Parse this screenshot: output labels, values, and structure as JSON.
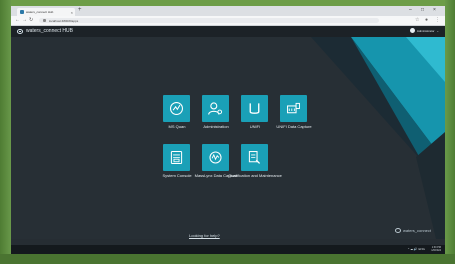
{
  "browser": {
    "tab_title": "waters_connect Hub",
    "new_tab": "+",
    "url": "localhost:4800/#/apps",
    "close_glyph": "×",
    "window_controls": [
      "–",
      "□",
      "×"
    ],
    "nav_icons": [
      "arrow-left-icon",
      "arrow-right-icon",
      "reload-icon"
    ]
  },
  "app": {
    "name": "waters_connect HUB",
    "user": "Administrator",
    "user_chevron": "⌄",
    "help_link": "Looking for help?",
    "brand_footer": "waters_connect"
  },
  "tiles": [
    {
      "label": "MS Quan",
      "icon": "ms-quan-icon"
    },
    {
      "label": "Administration",
      "icon": "administration-icon"
    },
    {
      "label": "UNIFI",
      "icon": "unifi-icon"
    },
    {
      "label": "UNIFI Data Capture",
      "icon": "unifi-data-capture-icon"
    },
    {
      "label": "System Console",
      "icon": "system-console-icon"
    },
    {
      "label": "MassLynx Data Capture",
      "icon": "masslynx-data-capture-icon"
    },
    {
      "label": "Qualification and Maintenance",
      "icon": "qualification-maintenance-icon"
    }
  ],
  "taskbar": {
    "tray_text": "^ ☁ 🔊 ENG",
    "time": "1:30 PM",
    "date": "1/8/2024"
  },
  "colors": {
    "tile": "#1aa0b7",
    "background": "#272f35",
    "accent_shape": "#1695ad"
  }
}
